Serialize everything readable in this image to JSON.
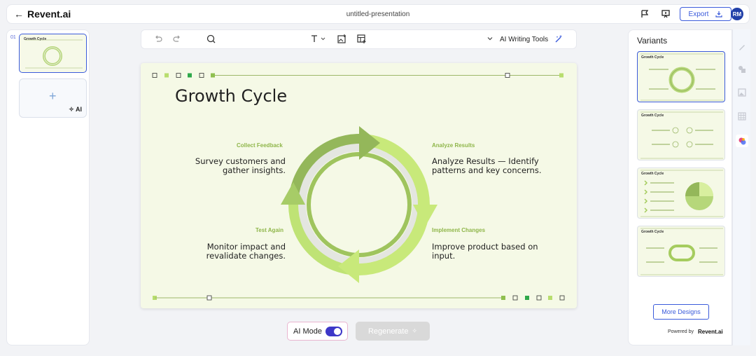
{
  "app": {
    "brand": "Revent.ai",
    "document_title": "untitled-presentation"
  },
  "topbar": {
    "export_label": "Export",
    "avatar_initials": "RM"
  },
  "left_panel": {
    "slide_number": "01",
    "thumb_title": "Growth Cycle",
    "add_ai_label": "AI"
  },
  "toolbar": {
    "ai_tools_label": "AI Writing Tools"
  },
  "slide": {
    "title": "Growth Cycle",
    "sections": {
      "top_left": {
        "heading": "Collect Feedback",
        "body": [
          "Survey customers and",
          "gather insights."
        ]
      },
      "top_right": {
        "heading": "Analyze Results",
        "body": [
          "Analyze Results — Identify",
          "patterns and key concerns."
        ]
      },
      "bottom_left": {
        "heading": "Test Again",
        "body": [
          "Monitor impact and",
          "revalidate changes."
        ]
      },
      "bottom_right": {
        "heading": "Implement Changes",
        "body": [
          "Improve product based on",
          "input."
        ]
      }
    }
  },
  "controls": {
    "ai_mode_label": "AI Mode",
    "ai_mode_on": true,
    "regenerate_label": "Regenerate"
  },
  "right_panel": {
    "title": "Variants",
    "variant_title": "Growth Cycle",
    "more_designs_label": "More Designs",
    "powered_by_label": "Powered by",
    "powered_brand": "Revent.ai"
  },
  "colors": {
    "accent": "#3b5bdb",
    "slide_bg": "#f5f9e6",
    "green_dark": "#94b75a",
    "green_light": "#c8e97a",
    "heading_green": "#8fb64a"
  }
}
